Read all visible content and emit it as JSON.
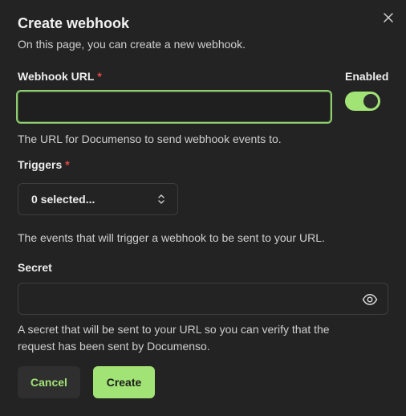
{
  "dialog": {
    "title": "Create webhook",
    "subtitle": "On this page, you can create a new webhook.",
    "close_icon": "close-icon"
  },
  "webhook_url": {
    "label": "Webhook URL",
    "required_mark": "*",
    "value": "",
    "placeholder": "",
    "help": "The URL for Documenso to send webhook events to."
  },
  "enabled": {
    "label": "Enabled",
    "checked": true
  },
  "triggers": {
    "label": "Triggers",
    "required_mark": "*",
    "selected_text": "0 selected...",
    "icon": "chevrons-up-down-icon",
    "help": "The events that will trigger a webhook to be sent to your URL."
  },
  "secret": {
    "label": "Secret",
    "value": "",
    "placeholder": "",
    "icon": "eye-icon",
    "help_line1": "A secret that will be sent to your URL so you can verify that the",
    "help_line2": "request has been sent by Documenso."
  },
  "actions": {
    "cancel_label": "Cancel",
    "create_label": "Create"
  },
  "colors": {
    "accent": "#a2e376",
    "required": "#e5484d",
    "background": "#232323"
  }
}
